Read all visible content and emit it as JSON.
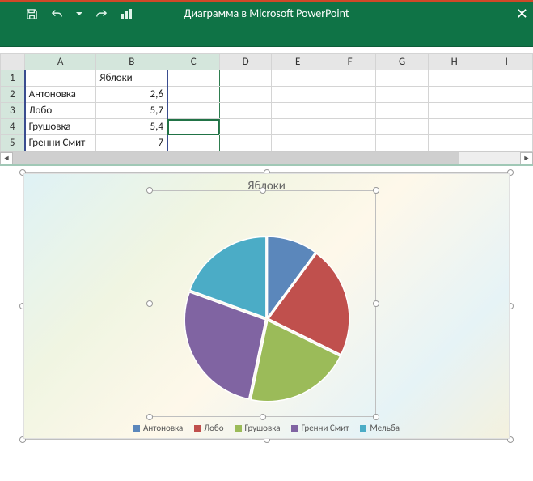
{
  "titlebar": {
    "title": "Диаграмма в Microsoft PowerPoint"
  },
  "columns": [
    "A",
    "B",
    "C",
    "D",
    "E",
    "F",
    "G",
    "H",
    "I"
  ],
  "rows": [
    {
      "n": "1",
      "A": "",
      "B": "Яблоки"
    },
    {
      "n": "2",
      "A": "Антоновка",
      "B": "2,6"
    },
    {
      "n": "3",
      "A": "Лобо",
      "B": "5,7"
    },
    {
      "n": "4",
      "A": "Грушовка",
      "B": "5,4"
    },
    {
      "n": "5",
      "A": "Гренни Смит",
      "B": "7"
    }
  ],
  "chart_data": {
    "type": "pie",
    "title": "Яблоки",
    "categories": [
      "Антоновка",
      "Лобо",
      "Грушовка",
      "Гренни Смит",
      "Мельба"
    ],
    "values": [
      2.6,
      5.7,
      5.4,
      7,
      5
    ],
    "colors": {
      "Антоновка": "#5b87bb",
      "Лобо": "#c0504d",
      "Грушовка": "#9bbb59",
      "Гренни Смит": "#8064a2",
      "Мельба": "#4bacc6"
    }
  },
  "legend": [
    {
      "label": "Антоновка",
      "color": "#5b87bb"
    },
    {
      "label": "Лобо",
      "color": "#c0504d"
    },
    {
      "label": "Грушовка",
      "color": "#9bbb59"
    },
    {
      "label": "Гренни Смит",
      "color": "#8064a2"
    },
    {
      "label": "Мельба",
      "color": "#4bacc6"
    }
  ]
}
